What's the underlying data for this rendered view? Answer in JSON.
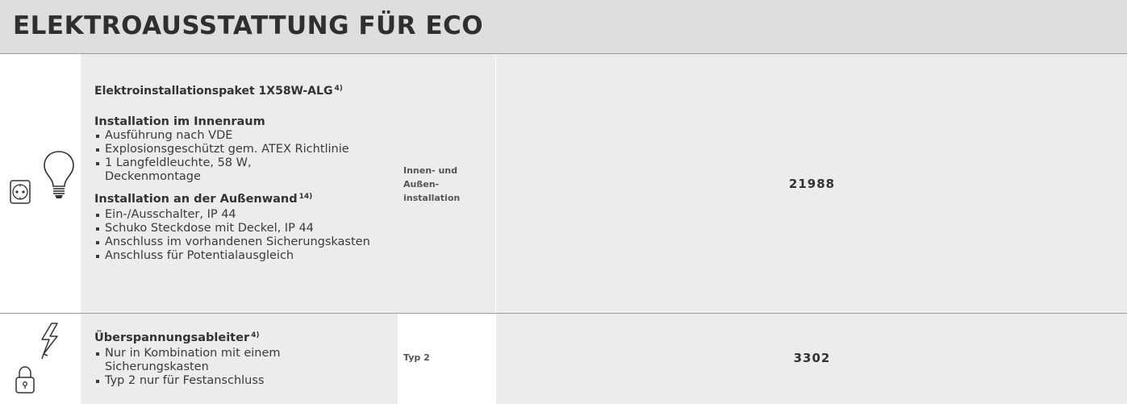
{
  "header": {
    "title": "ELEKTROAUSSTATTUNG FÜR ECO"
  },
  "rows": [
    {
      "icons": [
        "socket-icon",
        "lightbulb-icon"
      ],
      "title": "Elektroinstallationspaket 1X58W-ALG",
      "title_sup": "4)",
      "section1": {
        "heading": "Installation im Innenraum",
        "items": [
          "Ausführung nach VDE",
          "Explosionsgeschützt gem. ATEX Richtlinie",
          "1 Langfeldleuchte, 58 W, Deckenmontage"
        ]
      },
      "section2": {
        "heading": "Installation an der Außenwand",
        "heading_sup": "14)",
        "items": [
          "Ein-/Ausschalter, IP 44",
          "Schuko Steckdose mit Deckel, IP 44",
          "Anschluss im vorhandenen Sicherungskasten",
          "Anschluss für Potentialausgleich"
        ]
      },
      "variant": {
        "line1": "Innen- und",
        "line2": "Außen-",
        "line3": "installation"
      },
      "price": "21988"
    },
    {
      "icons": [
        "lightning-icon",
        "padlock-icon"
      ],
      "title": "Überspannungsableiter",
      "title_sup": "4)",
      "items": [
        "Nur in Kombination mit einem Sicherungskasten",
        "Typ 2 nur für Festanschluss"
      ],
      "variant": {
        "line1": "Typ 2"
      },
      "price": "3302"
    }
  ]
}
